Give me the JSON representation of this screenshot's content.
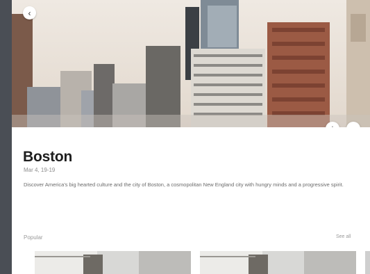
{
  "hero": {
    "back_icon": "chevron-left-icon",
    "add_icon": "plus-icon",
    "calendar_icon": "calendar-icon"
  },
  "city": {
    "name": "Boston",
    "dates": "Mar 4, 19-19",
    "description": "Discover America's big hearted culture and the city of Boston, a cosmopolitan New England city with hungry minds and a progressive spirit."
  },
  "popular": {
    "label": "Popular",
    "view_all": "See all"
  },
  "colors": {
    "rail": "#4a4e55",
    "sky": "#e9e2d9",
    "card_bg": "#ffffff"
  }
}
